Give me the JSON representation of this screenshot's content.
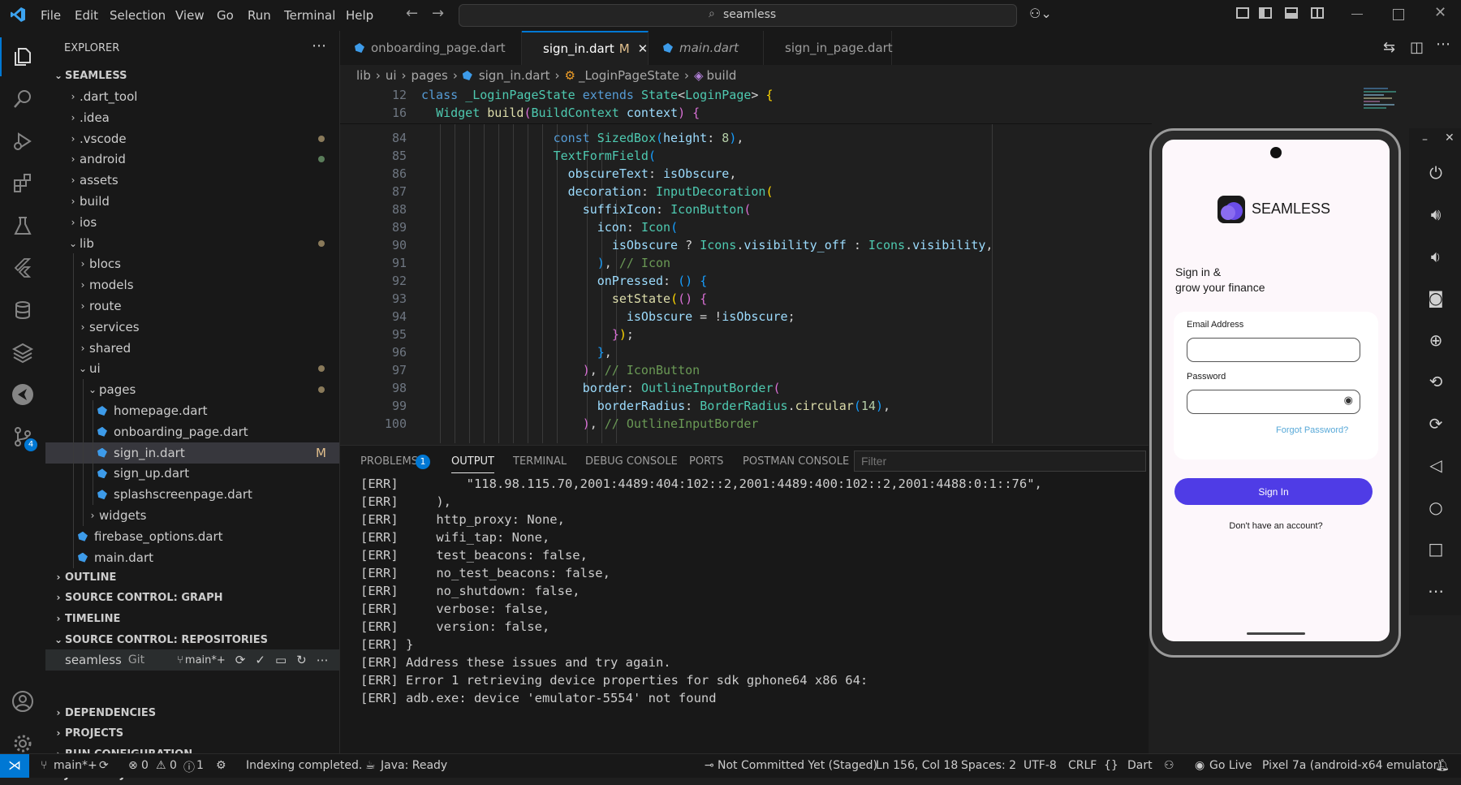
{
  "menu": [
    "File",
    "Edit",
    "Selection",
    "View",
    "Go",
    "Run",
    "Terminal",
    "Help"
  ],
  "search_text": "seamless",
  "explorer": {
    "title": "EXPLORER",
    "root": "SEAMLESS",
    "items": [
      {
        "label": ".dart_tool",
        "type": "folder",
        "depth": 1,
        "open": false,
        "dot": false
      },
      {
        "label": ".idea",
        "type": "folder",
        "depth": 1,
        "open": false,
        "dot": false
      },
      {
        "label": ".vscode",
        "type": "folder",
        "depth": 1,
        "open": false,
        "dot": true,
        "dot_color": "#8a7a5a"
      },
      {
        "label": "android",
        "type": "folder",
        "depth": 1,
        "open": false,
        "dot": true,
        "dot_color": "#5a7d5a"
      },
      {
        "label": "assets",
        "type": "folder",
        "depth": 1,
        "open": false,
        "dot": false
      },
      {
        "label": "build",
        "type": "folder",
        "depth": 1,
        "open": false,
        "dot": false
      },
      {
        "label": "ios",
        "type": "folder",
        "depth": 1,
        "open": false,
        "dot": false
      },
      {
        "label": "lib",
        "type": "folder",
        "depth": 1,
        "open": true,
        "dot": true,
        "dot_color": "#8a7a5a"
      },
      {
        "label": "blocs",
        "type": "folder",
        "depth": 2,
        "open": false,
        "dot": false
      },
      {
        "label": "models",
        "type": "folder",
        "depth": 2,
        "open": false,
        "dot": false
      },
      {
        "label": "route",
        "type": "folder",
        "depth": 2,
        "open": false,
        "dot": false
      },
      {
        "label": "services",
        "type": "folder",
        "depth": 2,
        "open": false,
        "dot": false
      },
      {
        "label": "shared",
        "type": "folder",
        "depth": 2,
        "open": false,
        "dot": false
      },
      {
        "label": "ui",
        "type": "folder",
        "depth": 2,
        "open": true,
        "dot": true,
        "dot_color": "#8a7a5a"
      },
      {
        "label": "pages",
        "type": "folder",
        "depth": 3,
        "open": true,
        "dot": true,
        "dot_color": "#8a7a5a"
      },
      {
        "label": "homepage.dart",
        "type": "file",
        "depth": 4,
        "dot": false
      },
      {
        "label": "onboarding_page.dart",
        "type": "file",
        "depth": 4,
        "dot": false
      },
      {
        "label": "sign_in.dart",
        "type": "file",
        "depth": 4,
        "selected": true,
        "badge": "M"
      },
      {
        "label": "sign_up.dart",
        "type": "file",
        "depth": 4,
        "dot": false
      },
      {
        "label": "splashscreenpage.dart",
        "type": "file",
        "depth": 4,
        "dot": false
      },
      {
        "label": "widgets",
        "type": "folder",
        "depth": 3,
        "open": false,
        "dot": false
      },
      {
        "label": "firebase_options.dart",
        "type": "file",
        "depth": 2,
        "dot": false
      },
      {
        "label": "main.dart",
        "type": "file",
        "depth": 2,
        "dot": false
      }
    ],
    "sections": [
      "OUTLINE",
      "SOURCE CONTROL: GRAPH",
      "TIMELINE",
      "SOURCE CONTROL: REPOSITORIES"
    ],
    "repo": {
      "name": "seamless",
      "kind": "Git",
      "branch": "main*+"
    },
    "lower_sections": [
      "DEPENDENCIES",
      "PROJECTS",
      "RUN CONFIGURATION",
      "JAVA PROJECTS"
    ]
  },
  "tabs": [
    {
      "label": "onboarding_page.dart",
      "italic": false,
      "active": false
    },
    {
      "label": "sign_in.dart",
      "badge": "M",
      "italic": false,
      "active": true
    },
    {
      "label": "main.dart",
      "italic": true,
      "active": false
    },
    {
      "label": "sign_in_page.dart",
      "italic": false,
      "active": false
    }
  ],
  "breadcrumb": [
    "lib",
    "ui",
    "pages",
    "sign_in.dart",
    "_LoginPageState",
    "build"
  ],
  "sticky": [
    {
      "num": "12",
      "text": "class _LoginPageState extends State<LoginPage> {"
    },
    {
      "num": "16",
      "text": "  Widget build(BuildContext context) {"
    }
  ],
  "code_lines": [
    "84",
    "85",
    "86",
    "87",
    "88",
    "89",
    "90",
    "91",
    "92",
    "93",
    "94",
    "95",
    "96",
    "97",
    "98",
    "99",
    "100"
  ],
  "panel": {
    "tabs": [
      "PROBLEMS",
      "OUTPUT",
      "TERMINAL",
      "DEBUG CONSOLE",
      "PORTS",
      "POSTMAN CONSOLE"
    ],
    "problems_count": "1",
    "filter_placeholder": "Filter",
    "output": [
      "[ERR]         \"118.98.115.70,2001:4489:404:102::2,2001:4489:400:102::2,2001:4488:0:1::76\",",
      "[ERR]     ),",
      "[ERR]     http_proxy: None,",
      "[ERR]     wifi_tap: None,",
      "[ERR]     test_beacons: false,",
      "[ERR]     no_test_beacons: false,",
      "[ERR]     no_shutdown: false,",
      "[ERR]     verbose: false,",
      "[ERR]     version: false,",
      "[ERR] }",
      "[ERR] Address these issues and try again.",
      "[ERR] Error 1 retrieving device properties for sdk gphone64 x86 64:",
      "[ERR] adb.exe: device 'emulator-5554' not found"
    ]
  },
  "status": {
    "branch": "main*+",
    "errors": "0",
    "warnings": "0",
    "infos": "1",
    "indexing": "Indexing completed.",
    "java": "Java: Ready",
    "commit": "Not Committed Yet (Staged)",
    "position": "Ln 156, Col 18",
    "spaces": "Spaces: 2",
    "encoding": "UTF-8",
    "eol": "CRLF",
    "language": "Dart",
    "golive": "Go Live",
    "device": "Pixel 7a (android-x64 emulator)"
  },
  "app": {
    "brand": "SEAMLESS",
    "heading_1": "Sign in &",
    "heading_2": "grow your finance",
    "email_label": "Email Address",
    "password_label": "Password",
    "forgot": "Forgot Password?",
    "signin": "Sign In",
    "no_account": "Don't have an account?",
    "accent": "#4f3ce6"
  }
}
